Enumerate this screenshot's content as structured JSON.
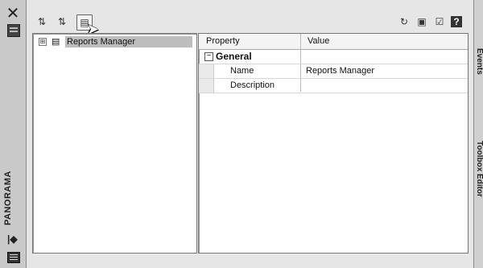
{
  "palette": {
    "sidebar": "panorama",
    "close_icon": "close-icon",
    "menu_icon": "menu-icon"
  },
  "palette_title": "PANORAMA",
  "toolbar": {
    "icons": [
      "sort-up-icon",
      "sort-down-icon",
      "reports-manager-icon",
      "refresh-icon",
      "save-icon",
      "check-icon",
      "help-icon"
    ]
  },
  "tree": {
    "items": [
      {
        "label": "Reports Manager",
        "expander": "⊞"
      }
    ]
  },
  "properties": {
    "headers": {
      "property": "Property",
      "value": "Value"
    },
    "category": {
      "toggle": "−",
      "name": "General"
    },
    "rows": [
      {
        "key": "Name",
        "value": "Reports Manager"
      },
      {
        "key": "Description",
        "value": ""
      }
    ]
  },
  "side_tabs": [
    "Events",
    "Toolbox Editor"
  ]
}
